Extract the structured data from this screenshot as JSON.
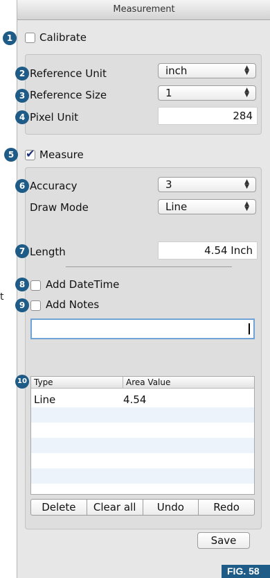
{
  "window": {
    "title": "Measurement"
  },
  "stray_text": "t",
  "callouts": [
    "1",
    "2",
    "3",
    "4",
    "5",
    "6",
    "7",
    "8",
    "9",
    "10"
  ],
  "calibrate": {
    "label": "Calibrate",
    "checked": false,
    "reference_unit": {
      "label": "Reference Unit",
      "value": "inch"
    },
    "reference_size": {
      "label": "Reference Size",
      "value": "1"
    },
    "pixel_unit": {
      "label": "Pixel Unit",
      "value": "284"
    }
  },
  "measure": {
    "label": "Measure",
    "checked": true,
    "accuracy": {
      "label": "Accuracy",
      "value": "3"
    },
    "draw_mode": {
      "label": "Draw Mode",
      "value": "Line"
    },
    "length": {
      "label": "Length",
      "value": "4.54 Inch"
    },
    "add_datetime": {
      "label": "Add DateTime",
      "checked": false
    },
    "add_notes": {
      "label": "Add Notes",
      "checked": false,
      "value": ""
    }
  },
  "table": {
    "columns": [
      "Type",
      "Area Value"
    ],
    "rows": [
      {
        "type": "Line",
        "value": "4.54"
      }
    ]
  },
  "buttons": {
    "delete": "Delete",
    "clear_all": "Clear all",
    "undo": "Undo",
    "redo": "Redo",
    "save": "Save"
  },
  "figure_label": "FIG. 58",
  "colors": {
    "callout": "#1e5b86",
    "checkmark": "#1d2f7a",
    "focus_ring": "#6fa2d6",
    "alt_row": "#edf3fb"
  }
}
